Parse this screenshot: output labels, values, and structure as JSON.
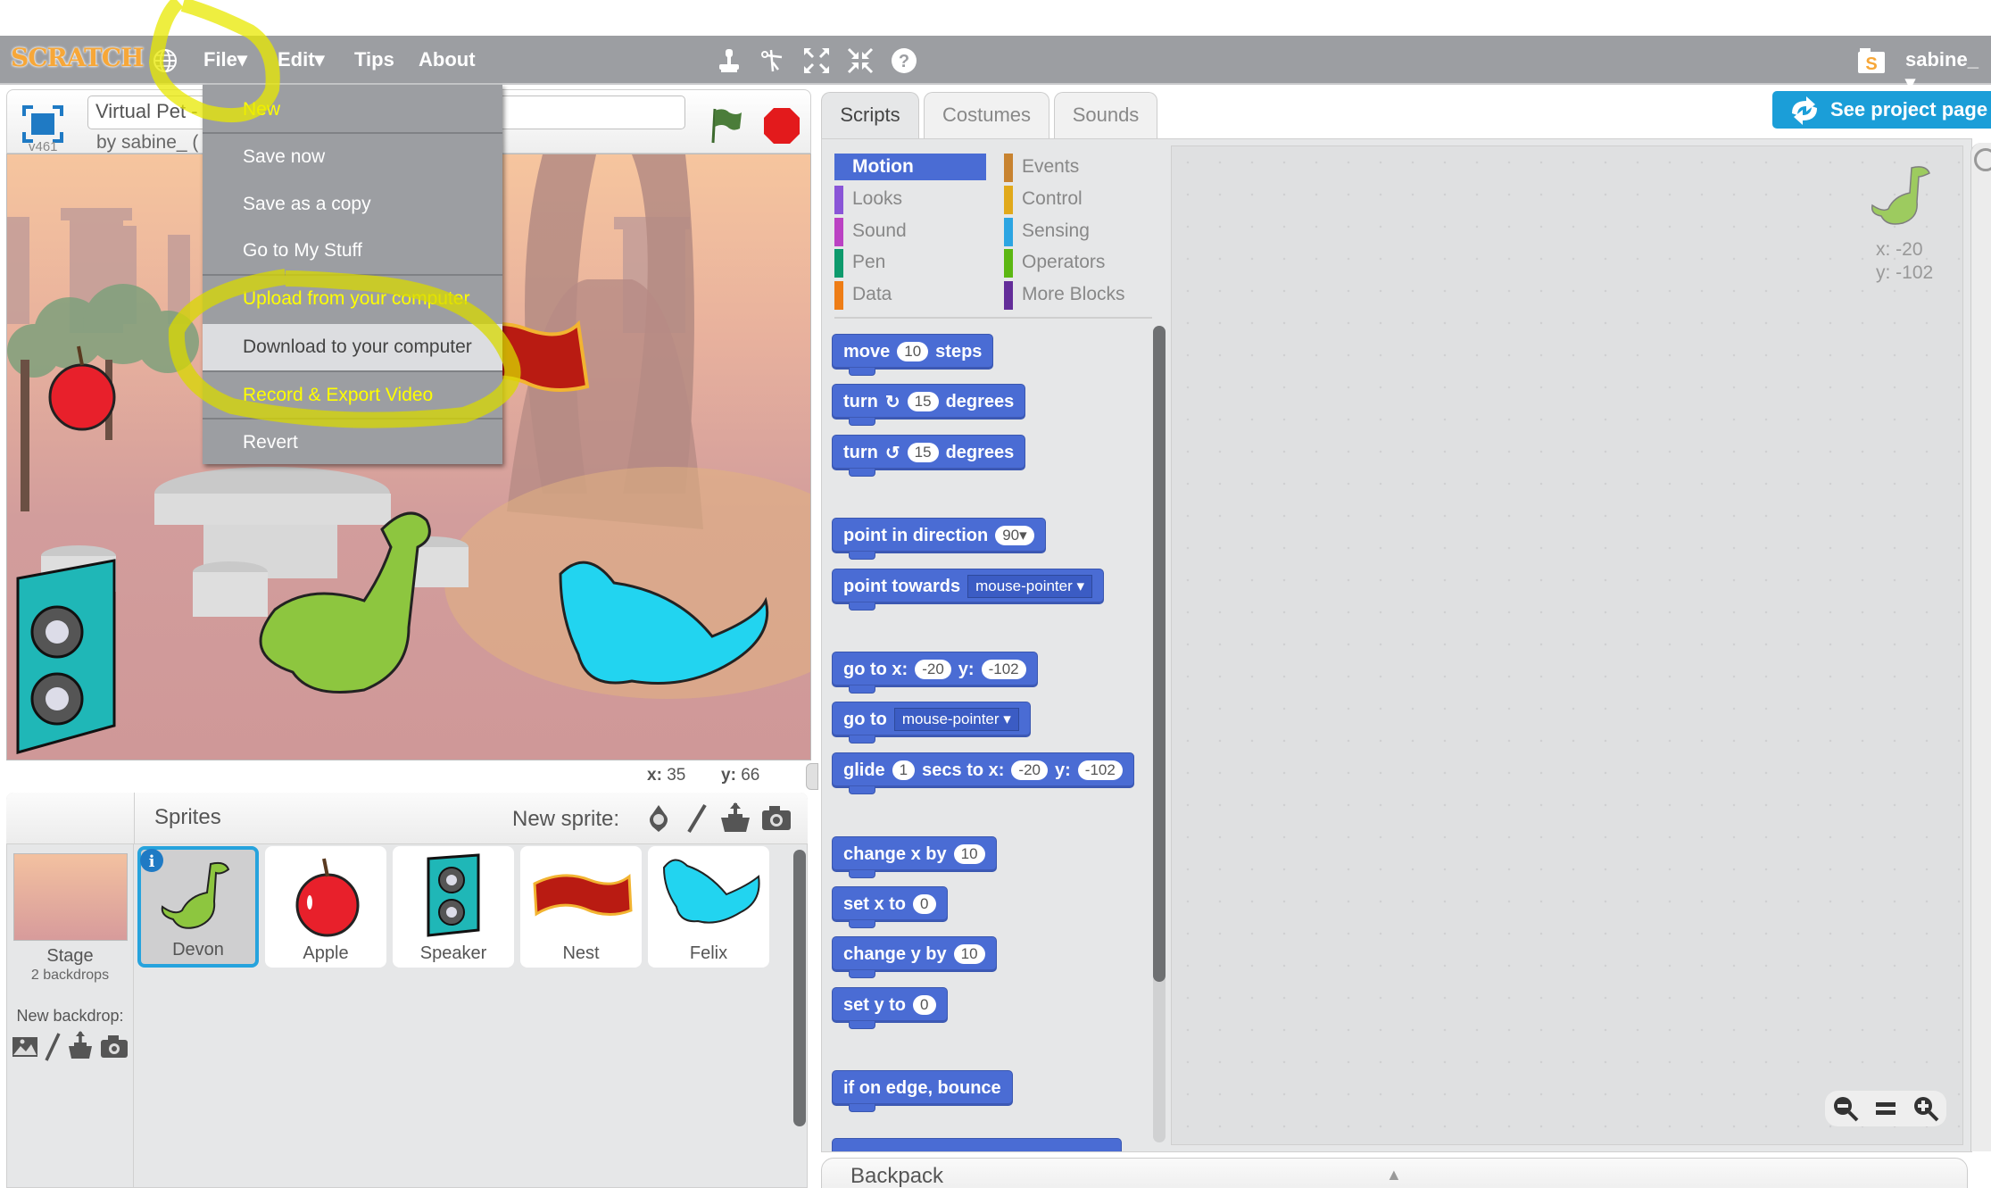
{
  "header": {
    "logo": "SCRATCH",
    "menu": [
      "File▾",
      "Edit▾",
      "Tips",
      "About"
    ],
    "toolbar_icons": [
      "duplicate-stamp-icon",
      "delete-scissors-icon",
      "grow-icon",
      "shrink-icon",
      "help-icon"
    ],
    "username": "sabine_ ▾"
  },
  "file_menu": {
    "items": [
      {
        "label": "New",
        "highlighted_by_annotation": true
      },
      {
        "label": "Save now"
      },
      {
        "label": "Save as a copy"
      },
      {
        "label": "Go to My Stuff"
      },
      {
        "label": "Upload from your computer",
        "highlighted_by_annotation": true
      },
      {
        "label": "Download to your computer",
        "hovered": true
      },
      {
        "label": "Record & Export Video",
        "highlighted_by_annotation": true
      },
      {
        "label": "Revert"
      }
    ]
  },
  "stage": {
    "project_title": "Virtual Pet -",
    "byline": "by sabine_ (",
    "version": "v461",
    "mouse_x_label": "x:",
    "mouse_x": "35",
    "mouse_y_label": "y:",
    "mouse_y": "66"
  },
  "sprites": {
    "header": "Sprites",
    "new_sprite_label": "New sprite:",
    "stage_label": "Stage",
    "stage_backdrops": "2 backdrops",
    "new_backdrop_label": "New backdrop:",
    "list": [
      {
        "name": "Devon",
        "selected": true
      },
      {
        "name": "Apple"
      },
      {
        "name": "Speaker"
      },
      {
        "name": "Nest"
      },
      {
        "name": "Felix"
      }
    ]
  },
  "editor": {
    "tabs": [
      "Scripts",
      "Costumes",
      "Sounds"
    ],
    "active_tab": "Scripts",
    "see_project_page": "See project page",
    "categories": [
      {
        "label": "Motion",
        "color": "#4a6cd4",
        "active": true
      },
      {
        "label": "Events",
        "color": "#c88330"
      },
      {
        "label": "Looks",
        "color": "#8a55d7"
      },
      {
        "label": "Control",
        "color": "#e1a91a"
      },
      {
        "label": "Sound",
        "color": "#bb42c3"
      },
      {
        "label": "Sensing",
        "color": "#2ca5e2"
      },
      {
        "label": "Pen",
        "color": "#0e9a6c"
      },
      {
        "label": "Operators",
        "color": "#5cb712"
      },
      {
        "label": "Data",
        "color": "#ee7d16"
      },
      {
        "label": "More Blocks",
        "color": "#632d99"
      }
    ],
    "blocks": {
      "move": {
        "a": "move",
        "n": "10",
        "b": "steps"
      },
      "turn_right": {
        "a": "turn",
        "n": "15",
        "b": "degrees"
      },
      "turn_left": {
        "a": "turn",
        "n": "15",
        "b": "degrees"
      },
      "point_dir": {
        "a": "point in direction",
        "n": "90▾"
      },
      "point_towards": {
        "a": "point towards",
        "d": "mouse-pointer ▾"
      },
      "goto_xy": {
        "a": "go to x:",
        "x": "-20",
        "b": "y:",
        "y": "-102"
      },
      "goto": {
        "a": "go to",
        "d": "mouse-pointer ▾"
      },
      "glide": {
        "a": "glide",
        "n": "1",
        "b": "secs to x:",
        "x": "-20",
        "c": "y:",
        "y": "-102"
      },
      "change_x": {
        "a": "change x by",
        "n": "10"
      },
      "set_x": {
        "a": "set x to",
        "n": "0"
      },
      "change_y": {
        "a": "change y by",
        "n": "10"
      },
      "set_y": {
        "a": "set y to",
        "n": "0"
      },
      "bounce": {
        "a": "if on edge, bounce"
      }
    },
    "sprite_info": {
      "x": "x: -20",
      "y": "y: -102"
    },
    "zoom": {
      "out": "−",
      "reset": "=",
      "in": "+"
    },
    "backpack": "Backpack"
  }
}
